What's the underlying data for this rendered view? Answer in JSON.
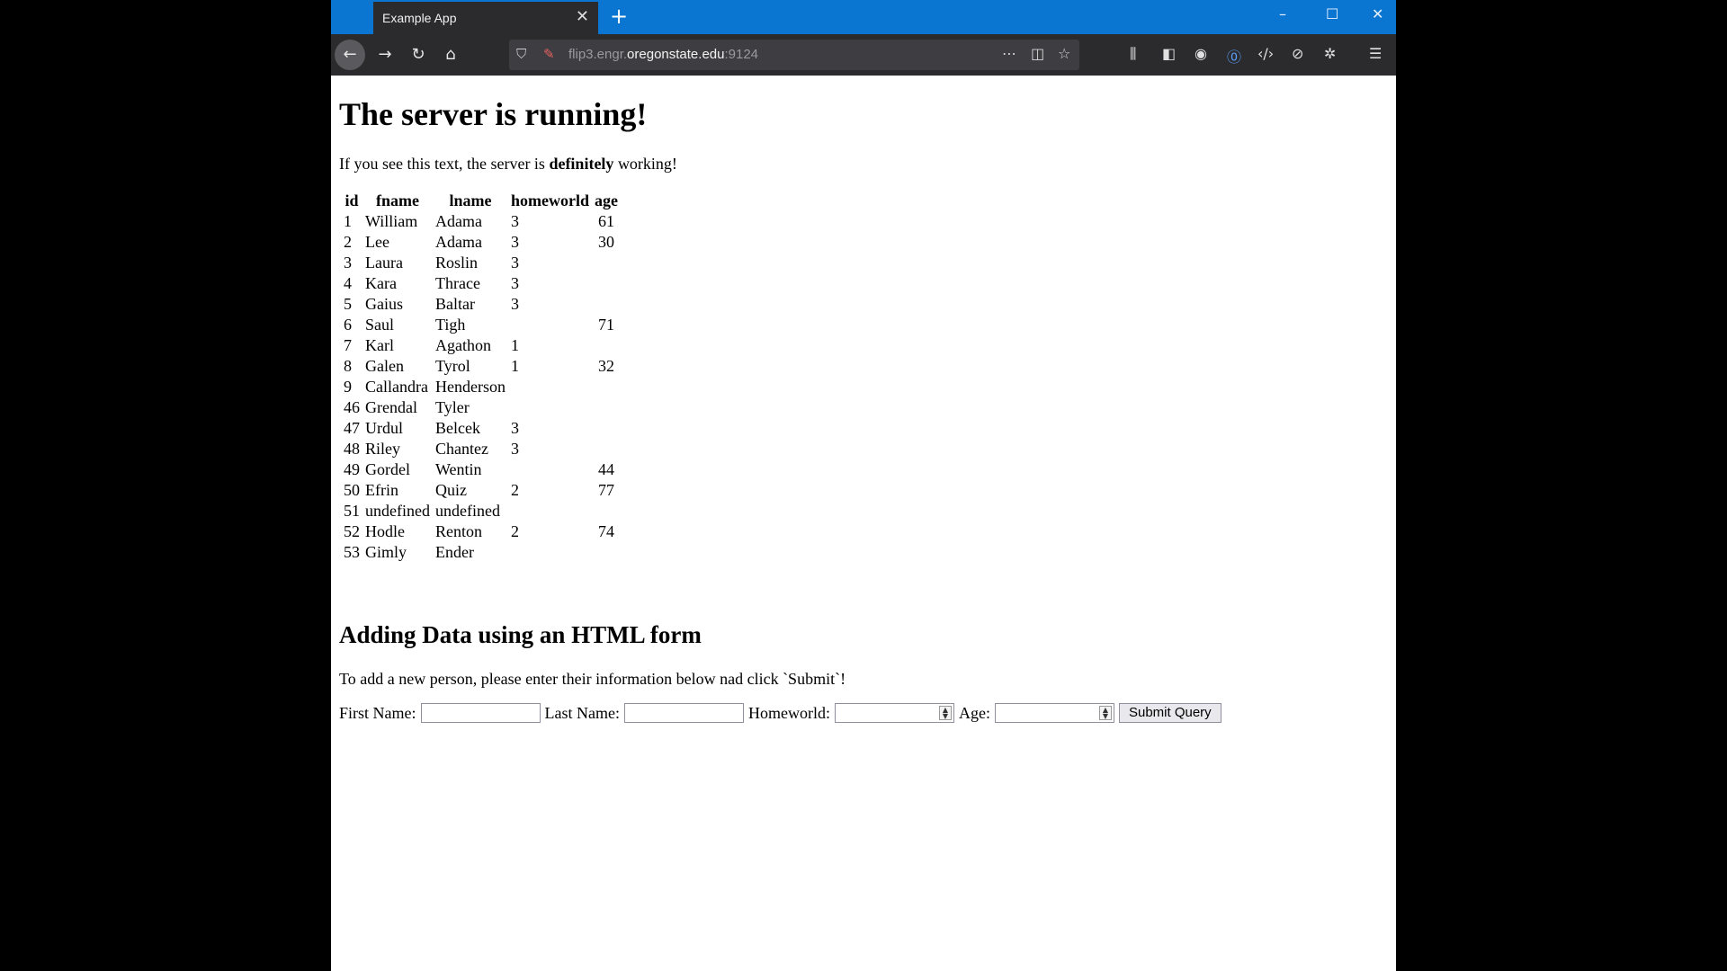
{
  "browser": {
    "tab_title": "Example App",
    "tab_close": "✕",
    "new_tab": "+",
    "url_prefix": "flip3.engr.",
    "url_host": "oregonstate.edu",
    "url_suffix": ":9124",
    "window_controls": {
      "minimize": "–",
      "maximize": "☐",
      "close": "✕"
    },
    "icons": {
      "back": "arrow-left-icon",
      "forward": "arrow-right-icon",
      "reload": "reload-icon",
      "home": "home-icon",
      "shield": "shield-icon",
      "insecure_lock": "insecure-lock-icon",
      "more": "more-dots-icon",
      "pocket": "pocket-icon",
      "bookmark": "star-icon",
      "library": "library-icon",
      "sidebar": "sidebar-icon",
      "account": "account-icon",
      "password": "password-manager-icon",
      "devtools": "devtools-icon",
      "extension1": "extension-icon",
      "extension2": "settings-gear-icon",
      "menu": "hamburger-menu-icon"
    },
    "colors": {
      "titlebar": "#0a76d1",
      "toolbar": "#2b2b2e",
      "urlbar": "#3e3e42"
    }
  },
  "page": {
    "heading": "The server is running!",
    "intro_before": "If you see this text, the server is ",
    "intro_bold": "definitely",
    "intro_after": " working!",
    "table": {
      "headers": [
        "id",
        "fname",
        "lname",
        "homeworld",
        "age"
      ],
      "rows": [
        [
          "1",
          "William",
          "Adama",
          "3",
          "61"
        ],
        [
          "2",
          "Lee",
          "Adama",
          "3",
          "30"
        ],
        [
          "3",
          "Laura",
          "Roslin",
          "3",
          ""
        ],
        [
          "4",
          "Kara",
          "Thrace",
          "3",
          ""
        ],
        [
          "5",
          "Gaius",
          "Baltar",
          "3",
          ""
        ],
        [
          "6",
          "Saul",
          "Tigh",
          "",
          "71"
        ],
        [
          "7",
          "Karl",
          "Agathon",
          "1",
          ""
        ],
        [
          "8",
          "Galen",
          "Tyrol",
          "1",
          "32"
        ],
        [
          "9",
          "Callandra",
          "Henderson",
          "",
          ""
        ],
        [
          "46",
          "Grendal",
          "Tyler",
          "",
          ""
        ],
        [
          "47",
          "Urdul",
          "Belcek",
          "3",
          ""
        ],
        [
          "48",
          "Riley",
          "Chantez",
          "3",
          ""
        ],
        [
          "49",
          "Gordel",
          "Wentin",
          "",
          "44"
        ],
        [
          "50",
          "Efrin",
          "Quiz",
          "2",
          "77"
        ],
        [
          "51",
          "undefined",
          "undefined",
          "",
          ""
        ],
        [
          "52",
          "Hodle",
          "Renton",
          "2",
          "74"
        ],
        [
          "53",
          "Gimly",
          "Ender",
          "",
          ""
        ]
      ]
    },
    "form_heading": "Adding Data using an HTML form",
    "form_intro": "To add a new person, please enter their information below nad click `Submit`!",
    "form": {
      "first_name_label": "First Name:",
      "first_name_value": "",
      "last_name_label": "Last Name:",
      "last_name_value": "",
      "homeworld_label": "Homeworld:",
      "homeworld_value": "",
      "age_label": "Age:",
      "age_value": "",
      "submit_label": "Submit Query"
    }
  }
}
